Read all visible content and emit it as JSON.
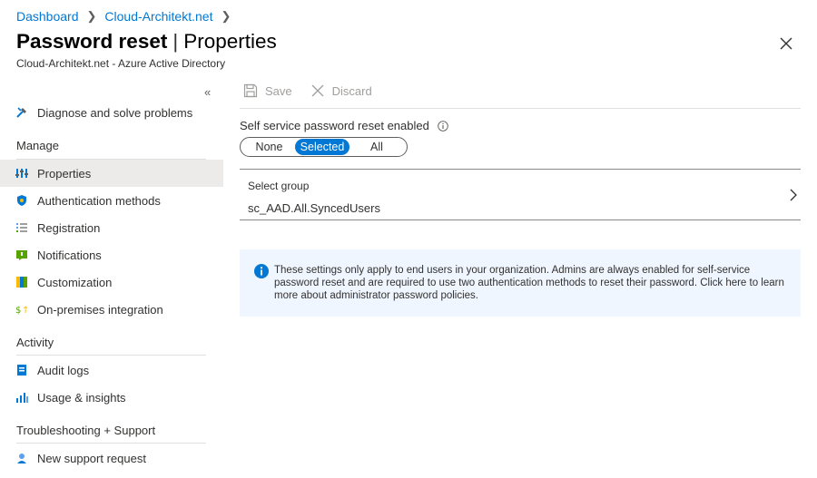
{
  "breadcrumb": {
    "home": "Dashboard",
    "tenant": "Cloud-Architekt.net"
  },
  "header": {
    "title_main": "Password reset",
    "title_separator": "|",
    "title_sub": "Properties",
    "subtitle": "Cloud-Architekt.net - Azure Active Directory"
  },
  "sidebar": {
    "collapse_label": "«",
    "top_item": {
      "label": "Diagnose and solve problems",
      "icon": "wrench-icon"
    },
    "sections": [
      {
        "label": "Manage"
      },
      {
        "label": "Activity"
      },
      {
        "label": "Troubleshooting + Support"
      }
    ],
    "items": [
      {
        "label": "Properties",
        "icon": "properties-icon",
        "active": true
      },
      {
        "label": "Authentication methods",
        "icon": "shield-icon"
      },
      {
        "label": "Registration",
        "icon": "list-icon"
      },
      {
        "label": "Notifications",
        "icon": "notification-icon"
      },
      {
        "label": "Customization",
        "icon": "customization-icon"
      },
      {
        "label": "On-premises integration",
        "icon": "onprem-icon"
      },
      {
        "label": "Audit logs",
        "icon": "log-icon"
      },
      {
        "label": "Usage & insights",
        "icon": "chart-icon"
      },
      {
        "label": "New support request",
        "icon": "support-icon"
      }
    ]
  },
  "toolbar": {
    "save_label": "Save",
    "discard_label": "Discard"
  },
  "sspr": {
    "label": "Self service password reset enabled",
    "options": [
      "None",
      "Selected",
      "All"
    ],
    "selected": "Selected"
  },
  "group": {
    "label": "Select group",
    "value": "sc_AAD.All.SyncedUsers"
  },
  "info": {
    "text": "These settings only apply to end users in your organization. Admins are always enabled for self-service password reset and are required to use two authentication methods to reset their password. Click here to learn more about administrator password policies."
  },
  "colors": {
    "accent": "#0078d4",
    "active_bg": "#edebe9",
    "info_bg": "#f0f6ff"
  }
}
